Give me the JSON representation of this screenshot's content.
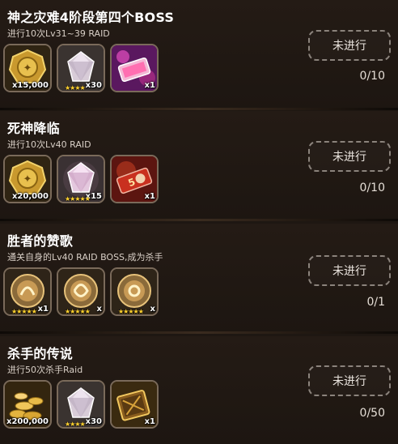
{
  "quests": [
    {
      "title": "神之灾难4阶段第四个BOSS",
      "desc": "进行10次Lv31~39 RAID",
      "button": "未进行",
      "progress": "0/10",
      "rewards": [
        {
          "icon": "gold-coin-medal-icon",
          "qty": "x15,000",
          "stars": ""
        },
        {
          "icon": "diamond-gem-icon",
          "qty": "x30",
          "stars": "★★★★"
        },
        {
          "icon": "pink-ticket-icon",
          "qty": "x1",
          "stars": ""
        }
      ]
    },
    {
      "title": "死神降临",
      "desc": "进行10次Lv40 RAID",
      "button": "未进行",
      "progress": "0/10",
      "rewards": [
        {
          "icon": "gold-coin-medal-icon",
          "qty": "x20,000",
          "stars": ""
        },
        {
          "icon": "pink-diamond-gem-icon",
          "qty": "x15",
          "stars": "★★★★★"
        },
        {
          "icon": "red-ticket-icon",
          "qty": "x1",
          "stars": ""
        }
      ]
    },
    {
      "title": "胜者的赞歌",
      "desc": "通关自身的Lv40 RAID BOSS,成为杀手",
      "button": "未进行",
      "progress": "0/1",
      "rewards": [
        {
          "icon": "enhance-orb-icon",
          "qty": "x1",
          "stars": "★★★★★"
        },
        {
          "icon": "enhance-orb-icon",
          "qty": "x",
          "stars": "★★★★★"
        },
        {
          "icon": "enhance-orb-icon",
          "qty": "x",
          "stars": "★★★★★"
        }
      ]
    },
    {
      "title": "杀手的传说",
      "desc": "进行50次杀手Raid",
      "button": "未进行",
      "progress": "0/50",
      "rewards": [
        {
          "icon": "gold-coins-pile-icon",
          "qty": "x200,000",
          "stars": ""
        },
        {
          "icon": "diamond-gem-icon",
          "qty": "x30",
          "stars": "★★★★"
        },
        {
          "icon": "gold-ticket-icon",
          "qty": "x1",
          "stars": ""
        }
      ]
    }
  ]
}
